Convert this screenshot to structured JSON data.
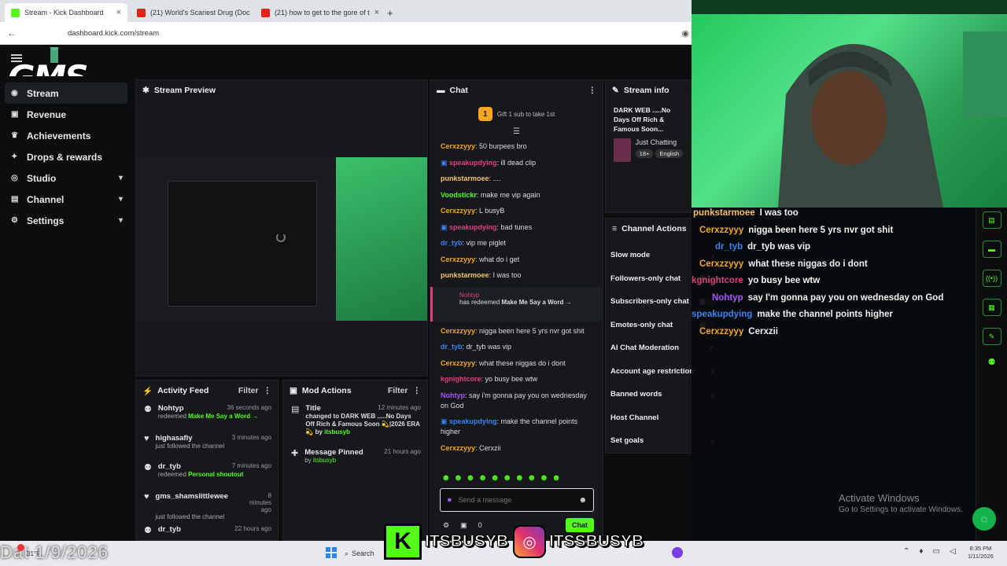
{
  "browser": {
    "tabs": [
      {
        "title": "Stream - Kick Dashboard",
        "active": true
      },
      {
        "title": "(21) World's Scariest Drug (Doc"
      },
      {
        "title": "(21) how to get to the gore of t"
      }
    ],
    "url": "dashboard.kick.com/stream"
  },
  "logo": {
    "text": "GMS"
  },
  "sidebar": {
    "items": [
      {
        "label": "Stream",
        "active": true
      },
      {
        "label": "Revenue"
      },
      {
        "label": "Achievements"
      },
      {
        "label": "Drops & rewards"
      },
      {
        "label": "Studio",
        "expandable": true
      },
      {
        "label": "Channel",
        "expandable": true
      },
      {
        "label": "Settings",
        "expandable": true
      }
    ]
  },
  "preview": {
    "title": "Stream Preview"
  },
  "activity": {
    "title": "Activity Feed",
    "filter": "Filter",
    "items": [
      {
        "user": "Nohtyp",
        "time": "36 seconds ago",
        "text": "redeemed",
        "link": "Make Me Say a Word →"
      },
      {
        "user": "highasafly",
        "time": "3 minutes ago",
        "text": "just followed the channel",
        "link": ""
      },
      {
        "user": "dr_tyb",
        "time": "7 minutes ago",
        "text": "redeemed",
        "link": "Personal shoutout"
      },
      {
        "user": "gms_shamslittlewee",
        "time": "8 minutes ago",
        "text": "just followed the channel",
        "link": ""
      },
      {
        "user": "dr_tyb",
        "time": "22 hours ago",
        "text": "",
        "link": ""
      }
    ]
  },
  "mod": {
    "title": "Mod Actions",
    "filter": "Filter",
    "items": [
      {
        "title": "Title",
        "time": "12 minutes ago",
        "detail": "changed to DARK WEB .....No Days Off Rich & Famous Soon 💫|2026 ERA💫 by",
        "by": "itsbusyb"
      },
      {
        "title": "Message Pinned",
        "time": "21 hours ago",
        "detail": "by",
        "by": "itsbusyb"
      }
    ]
  },
  "chat": {
    "title": "Chat",
    "gift": {
      "count": "1",
      "text": "Gift 1 sub to take 1st"
    },
    "messages": [
      {
        "user": "Cerxzzyyy",
        "color": "#f5a623",
        "text": "50 burpees bro"
      },
      {
        "user": "speakupdying",
        "color": "#e0417a",
        "text": "ill dead clip",
        "badge": true
      },
      {
        "user": "punkstarmoee",
        "color": "#f5c06b",
        "text": "...."
      },
      {
        "user": "Voodstickr",
        "color": "#53fc18",
        "text": "make me vip again"
      },
      {
        "user": "Cerxzzyyy",
        "color": "#f5a623",
        "text": "L busyB"
      },
      {
        "user": "speakupdying",
        "color": "#e0417a",
        "text": "bad tunes",
        "badge": true
      },
      {
        "user": "dr_tyb",
        "color": "#3b82f6",
        "text": "vip me piglet"
      },
      {
        "user": "Cerxzzyyy",
        "color": "#f5a623",
        "text": "what do i get"
      },
      {
        "user": "punkstarmoee",
        "color": "#f5c06b",
        "text": "I was too"
      }
    ],
    "redeem": {
      "user": "Nohtyp",
      "text": "has redeemed",
      "reward": "Make Me Say a Word →"
    },
    "messages2": [
      {
        "user": "Cerxzzyyy",
        "color": "#f5a623",
        "text": "nigga been here 5 yrs nvr got shit"
      },
      {
        "user": "dr_tyb",
        "color": "#3b82f6",
        "text": "dr_tyb was vip"
      },
      {
        "user": "Cerxzzyyy",
        "color": "#f5a623",
        "text": "what these niggas do i dont"
      },
      {
        "user": "kgnightcore",
        "color": "#e0417a",
        "text": "yo busy bee wtw"
      },
      {
        "user": "Nohtyp",
        "color": "#a855f7",
        "text": "say i'm gonna pay you on wednesday on God"
      },
      {
        "user": "speakupdying",
        "color": "#3b82f6",
        "text": "make the channel points higher",
        "badge": true
      },
      {
        "user": "Cerxzzyyy",
        "color": "#f5a623",
        "text": "Cerxzii"
      }
    ],
    "placeholder": "Send a message",
    "points": "0",
    "send": "Chat"
  },
  "info": {
    "title": "Stream info",
    "stream_title": "DARK WEB .....No Days Off Rich & Famous Soon...",
    "category": "Just Chatting",
    "tags": [
      "18+",
      "English"
    ]
  },
  "actions": {
    "title": "Channel Actions",
    "items": [
      {
        "label": "Slow mode",
        "kind": "chev"
      },
      {
        "label": "Followers-only chat",
        "kind": "toggle"
      },
      {
        "label": "Subscribers-only chat",
        "kind": "toggle"
      },
      {
        "label": "Emotes-only chat",
        "kind": "toggle"
      },
      {
        "label": "AI Chat Moderation",
        "kind": "ext"
      },
      {
        "label": "Account age restriction",
        "kind": "chev"
      },
      {
        "label": "Banned words",
        "kind": "chev"
      },
      {
        "label": "Host Channel",
        "kind": "none"
      },
      {
        "label": "Set goals",
        "kind": "chev"
      }
    ]
  },
  "overlay": {
    "lines": [
      {
        "user": "punkstarmoee",
        "color": "#f5c06b",
        "text": "I was too"
      },
      {
        "user": "Cerxzzyyy",
        "color": "#f5a623",
        "text": "nigga been here 5 yrs nvr got shit"
      },
      {
        "user": "dr_tyb",
        "color": "#3b82f6",
        "text": "dr_tyb was vip"
      },
      {
        "user": "Cerxzzyyy",
        "color": "#f5a623",
        "text": "what these niggas do i dont"
      },
      {
        "user": "kgnightcore",
        "color": "#e0417a",
        "text": "yo busy bee wtw"
      },
      {
        "user": "Nohtyp",
        "color": "#a855f7",
        "text": "say I'm gonna pay you on wednesday on God"
      },
      {
        "user": "speakupdying",
        "color": "#3b82f6",
        "text": "make the channel points higher"
      },
      {
        "user": "Cerxzzyyy",
        "color": "#f5a623",
        "text": "Cerxzii"
      }
    ],
    "activate_title": "Activate Windows",
    "activate_sub": "Go to Settings to activate Windows.",
    "handle1": "ITSBUSYB",
    "handle2": "ITSSBUSYB"
  },
  "taskbar": {
    "weather": "31°F",
    "date_overlay": "Dat 1/9/2026",
    "search": "Search",
    "time": "8:35 PM",
    "date": "1/11/2026"
  },
  "colors": {
    "kick_green": "#53fc18",
    "panel": "#16181c",
    "bg": "#0b0d0f"
  }
}
